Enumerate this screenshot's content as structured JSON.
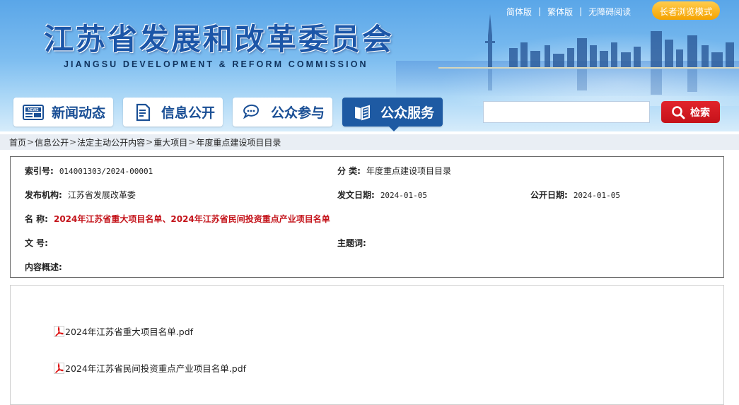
{
  "header": {
    "title": "江苏省发展和改革委员会",
    "subtitle": "JIANGSU DEVELOPMENT & REFORM COMMISSION",
    "links": [
      "简体版",
      "繁体版",
      "无障碍阅读"
    ],
    "separator": "|",
    "elder_mode": "长者浏览模式"
  },
  "nav": {
    "items": [
      {
        "label": "新闻动态",
        "icon": "news-icon"
      },
      {
        "label": "信息公开",
        "icon": "document-icon"
      },
      {
        "label": "公众参与",
        "icon": "chat-icon"
      },
      {
        "label": "公众服务",
        "icon": "book-icon"
      }
    ],
    "active_index": 3
  },
  "search": {
    "value": "",
    "placeholder": "",
    "button_label": "检索"
  },
  "breadcrumb": {
    "items": [
      "首页",
      "信息公开",
      "法定主动公开内容",
      "重大项目",
      "年度重点建设项目目录"
    ],
    "separator": ">"
  },
  "info": {
    "index_label": "索引号:",
    "index_value": "014001303/2024-00001",
    "category_label": "分 类:",
    "category_value": "年度重点建设项目目录",
    "publisher_label": "发布机构:",
    "publisher_value": "江苏省发展改革委",
    "issue_date_label": "发文日期:",
    "issue_date_value": "2024-01-05",
    "public_date_label": "公开日期:",
    "public_date_value": "2024-01-05",
    "name_label": "名 称:",
    "name_value": "2024年江苏省重大项目名单、2024年江苏省民间投资重点产业项目名单",
    "doc_no_label": "文 号:",
    "doc_no_value": "",
    "keywords_label": "主题词:",
    "keywords_value": "",
    "summary_label": "内容概述:",
    "summary_value": ""
  },
  "attachments": [
    {
      "name": "2024年江苏省重大项目名单.pdf"
    },
    {
      "name": "2024年江苏省民间投资重点产业项目名单.pdf"
    }
  ],
  "colors": {
    "brand_blue": "#1e5aa3",
    "title_red": "#c4141b",
    "search_red": "#d81c23",
    "elder_orange": "#f5a300"
  }
}
